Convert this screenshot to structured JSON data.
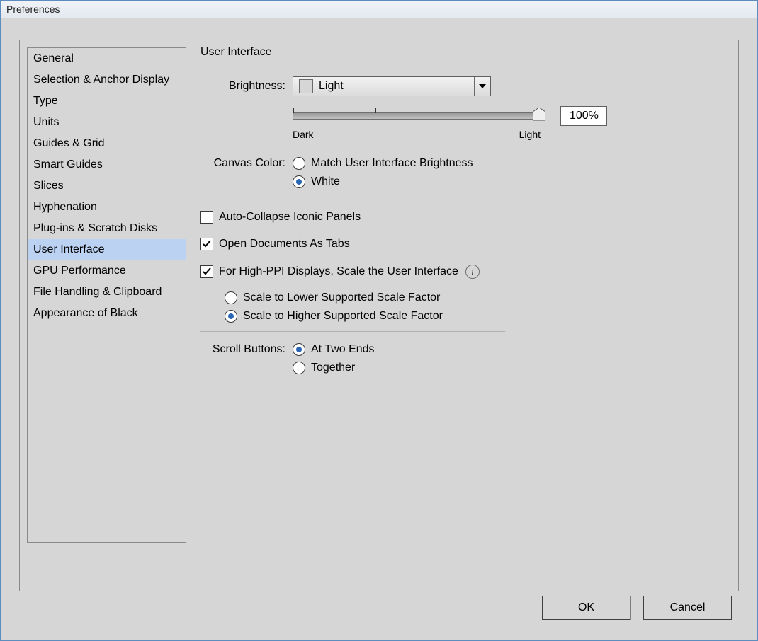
{
  "window": {
    "title": "Preferences"
  },
  "nav": {
    "items": [
      {
        "label": "General"
      },
      {
        "label": "Selection & Anchor Display"
      },
      {
        "label": "Type"
      },
      {
        "label": "Units"
      },
      {
        "label": "Guides & Grid"
      },
      {
        "label": "Smart Guides"
      },
      {
        "label": "Slices"
      },
      {
        "label": "Hyphenation"
      },
      {
        "label": "Plug-ins & Scratch Disks"
      },
      {
        "label": "User Interface"
      },
      {
        "label": "GPU Performance"
      },
      {
        "label": "File Handling & Clipboard"
      },
      {
        "label": "Appearance of Black"
      }
    ],
    "selectedIndex": 9
  },
  "panel": {
    "title": "User Interface",
    "brightness": {
      "label": "Brightness:",
      "selected": "Light",
      "slider": {
        "minLabel": "Dark",
        "maxLabel": "Light",
        "valueLabel": "100%"
      }
    },
    "canvasColor": {
      "label": "Canvas Color:",
      "options": [
        {
          "label": "Match User Interface Brightness",
          "selected": false
        },
        {
          "label": "White",
          "selected": true
        }
      ]
    },
    "autoCollapse": {
      "label": "Auto-Collapse Iconic Panels",
      "checked": false
    },
    "openAsTabs": {
      "label": "Open Documents As Tabs",
      "checked": true
    },
    "hiPPI": {
      "label": "For High-PPI Displays, Scale the User Interface",
      "checked": true,
      "options": [
        {
          "label": "Scale to Lower Supported Scale Factor",
          "selected": false
        },
        {
          "label": "Scale to Higher Supported Scale Factor",
          "selected": true
        }
      ]
    },
    "scrollButtons": {
      "label": "Scroll Buttons:",
      "options": [
        {
          "label": "At Two Ends",
          "selected": true
        },
        {
          "label": "Together",
          "selected": false
        }
      ]
    }
  },
  "buttons": {
    "ok": "OK",
    "cancel": "Cancel"
  }
}
